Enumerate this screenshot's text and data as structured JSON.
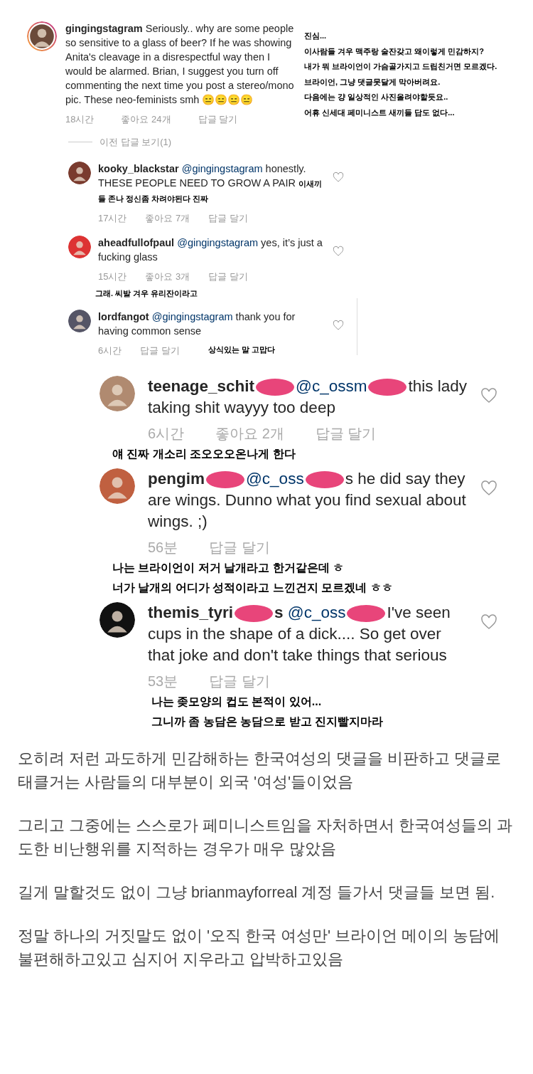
{
  "top_comment": {
    "user": "gingingstagram",
    "text": "Seriously.. why are some people so sensitive to a glass of beer? If he was showing Anita's cleavage in a disrespectful way then I would be alarmed. Brian, I suggest you turn off commenting the next time you post a stereo/mono pic. These neo-feminists smh 😑😑😑😑",
    "story_ring": true,
    "time": "18시간",
    "likes": "좋아요 24개",
    "reply": "답글 달기",
    "translation": [
      "진심...",
      "이사람들 겨우 맥주랑 술잔갖고 왜이렇게 민감하지?",
      "내가 뭐 브라이언이 가슴골가지고 드립친거면 모르겠다.",
      "브라이언, 그냥 댓글못달게 막아버려요.",
      "다음에는 걍 일상적인 사진올려야할듯요..",
      "어휴 신세대 페미니스트 새끼들 답도 없다..."
    ]
  },
  "view_replies": "이전 답글 보기(1)",
  "replies": [
    {
      "user": "kooky_blackstar",
      "mention": "@gingingstagram",
      "text": "honestly. THESE PEOPLE NEED TO GROW A PAIR",
      "time": "17시간",
      "likes": "좋아요 7개",
      "reply": "답글 달기",
      "translation": "이새끼들 존나 정신좀 차려야된다 진짜",
      "kind": "inline"
    },
    {
      "user": "aheadfullofpaul",
      "mention": "@gingingstagram",
      "text": "yes, it’s just a fucking glass",
      "time": "15시간",
      "likes": "좋아요 3개",
      "reply": "답글 달기",
      "translation": "그래. 씨발 겨우 유리잔이라고",
      "kind": "below"
    },
    {
      "user": "lordfangot",
      "mention": "@gingingstagram",
      "text": "thank you for having common sense",
      "time": "6시간",
      "reply": "답글 달기",
      "translation": "상식있는 말 고맙다",
      "kind": "meta"
    }
  ],
  "zoomed_replies": [
    {
      "parts": [
        {
          "kind": "user",
          "text": "teenage_schit"
        },
        {
          "kind": "blob"
        },
        {
          "kind": "mention",
          "text": "@c_ossm"
        },
        {
          "kind": "blob"
        },
        {
          "kind": "text",
          "text": "this lady taking shit wayyy too deep"
        }
      ],
      "time": "6시간",
      "likes": "좋아요 2개",
      "reply": "답글 달기",
      "translation": [
        "얘 진짜 개소리 조오오오온나게 한다"
      ]
    },
    {
      "parts": [
        {
          "kind": "user",
          "text": "pengim"
        },
        {
          "kind": "blob"
        },
        {
          "kind": "mention",
          "text": "@c_oss"
        },
        {
          "kind": "blob"
        },
        {
          "kind": "text",
          "text": "s he did say they are wings. Dunno what you find sexual about wings. ;)"
        }
      ],
      "time": "56분",
      "reply": "답글 달기",
      "translation": [
        "나는 브라이언이 저거 날개라고 한거같은데 ㅎ",
        "너가 날개의 어디가 성적이라고 느낀건지 모르겠네 ㅎㅎ"
      ]
    },
    {
      "parts": [
        {
          "kind": "user",
          "text": "themis_tyri"
        },
        {
          "kind": "blob"
        },
        {
          "kind": "user",
          "text": "s"
        },
        {
          "kind": "mention",
          "text": "@c_oss"
        },
        {
          "kind": "blob"
        },
        {
          "kind": "text",
          "text": "I've seen cups in the shape of a dick.... So get over that joke and don't take things that serious"
        }
      ],
      "time": "53분",
      "reply": "답글 달기",
      "translation": [
        "나는 좆모양의 컵도 본적이 있어...",
        "그니까 좀 농담은 농담으로 받고 진지빨지마라"
      ]
    }
  ],
  "article": [
    "오히려 저런 과도하게 민감해하는 한국여성의 댓글을 비판하고 댓글로 태클거는 사람들의 대부분이 외국 '여성'들이었음",
    "그리고 그중에는 스스로가 페미니스트임을 자처하면서 한국여성들의 과도한 비난행위를 지적하는 경우가 매우 많았음",
    "길게 말할것도 없이 그냥 brianmayforreal 계정 들가서 댓글들 보면 됨.",
    "정말 하나의 거짓말도 없이 '오직 한국 여성만' 브라이언 메이의 농담에 불편해하고있고 심지어 지우라고 압박하고있음"
  ]
}
